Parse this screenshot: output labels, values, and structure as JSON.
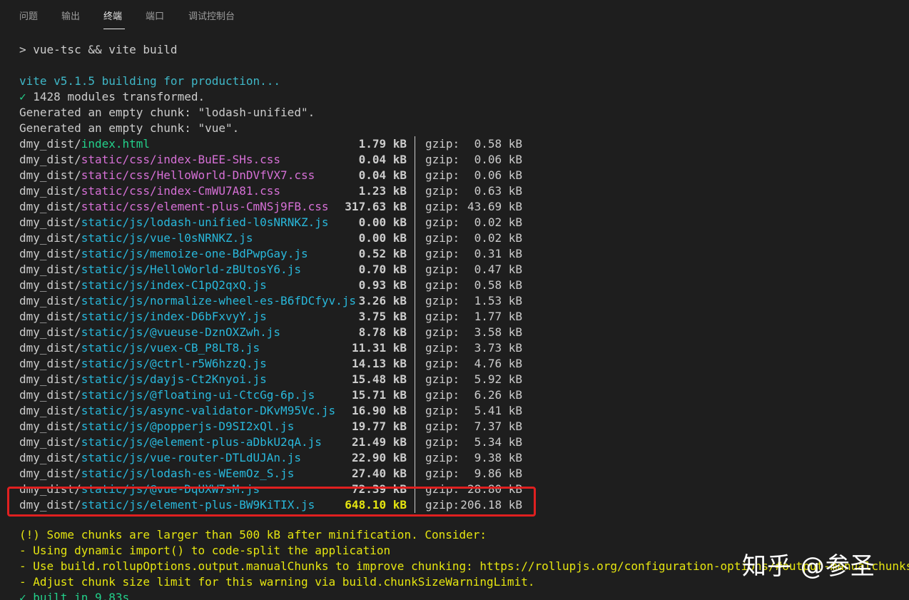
{
  "tabs": [
    {
      "label": "问题"
    },
    {
      "label": "输出"
    },
    {
      "label": "终端"
    },
    {
      "label": "端口"
    },
    {
      "label": "调试控制台"
    }
  ],
  "terminal": {
    "command": "> vue-tsc && vite build",
    "vite_header": "vite v5.1.5 building for production...",
    "check_mark": "✓",
    "modules": " 1428 modules transformed.",
    "empty_chunk_1": "Generated an empty chunk: \"lodash-unified\".",
    "empty_chunk_2": "Generated an empty chunk: \"vue\".",
    "gzip_label": "gzip:",
    "files": [
      {
        "dir": "dmy_dist/",
        "name": "index.html",
        "kind": "html",
        "size": "1.79 kB",
        "gzip": "0.58 kB"
      },
      {
        "dir": "dmy_dist/",
        "name": "static/css/index-BuEE-SHs.css",
        "kind": "css",
        "size": "0.04 kB",
        "gzip": "0.06 kB"
      },
      {
        "dir": "dmy_dist/",
        "name": "static/css/HelloWorld-DnDVfVX7.css",
        "kind": "css",
        "size": "0.04 kB",
        "gzip": "0.06 kB"
      },
      {
        "dir": "dmy_dist/",
        "name": "static/css/index-CmWU7A81.css",
        "kind": "css",
        "size": "1.23 kB",
        "gzip": "0.63 kB"
      },
      {
        "dir": "dmy_dist/",
        "name": "static/css/element-plus-CmNSj9FB.css",
        "kind": "css",
        "size": "317.63 kB",
        "gzip": "43.69 kB"
      },
      {
        "dir": "dmy_dist/",
        "name": "static/js/lodash-unified-l0sNRNKZ.js",
        "kind": "js",
        "size": "0.00 kB",
        "gzip": "0.02 kB"
      },
      {
        "dir": "dmy_dist/",
        "name": "static/js/vue-l0sNRNKZ.js",
        "kind": "js",
        "size": "0.00 kB",
        "gzip": "0.02 kB"
      },
      {
        "dir": "dmy_dist/",
        "name": "static/js/memoize-one-BdPwpGay.js",
        "kind": "js",
        "size": "0.52 kB",
        "gzip": "0.31 kB"
      },
      {
        "dir": "dmy_dist/",
        "name": "static/js/HelloWorld-zBUtosY6.js",
        "kind": "js",
        "size": "0.70 kB",
        "gzip": "0.47 kB"
      },
      {
        "dir": "dmy_dist/",
        "name": "static/js/index-C1pQ2qxQ.js",
        "kind": "js",
        "size": "0.93 kB",
        "gzip": "0.58 kB"
      },
      {
        "dir": "dmy_dist/",
        "name": "static/js/normalize-wheel-es-B6fDCfyv.js",
        "kind": "js",
        "size": "3.26 kB",
        "gzip": "1.53 kB"
      },
      {
        "dir": "dmy_dist/",
        "name": "static/js/index-D6bFxvyY.js",
        "kind": "js",
        "size": "3.75 kB",
        "gzip": "1.77 kB"
      },
      {
        "dir": "dmy_dist/",
        "name": "static/js/@vueuse-DznOXZwh.js",
        "kind": "js",
        "size": "8.78 kB",
        "gzip": "3.58 kB"
      },
      {
        "dir": "dmy_dist/",
        "name": "static/js/vuex-CB_P8LT8.js",
        "kind": "js",
        "size": "11.31 kB",
        "gzip": "3.73 kB"
      },
      {
        "dir": "dmy_dist/",
        "name": "static/js/@ctrl-r5W6hzzQ.js",
        "kind": "js",
        "size": "14.13 kB",
        "gzip": "4.76 kB"
      },
      {
        "dir": "dmy_dist/",
        "name": "static/js/dayjs-Ct2Knyoi.js",
        "kind": "js",
        "size": "15.48 kB",
        "gzip": "5.92 kB"
      },
      {
        "dir": "dmy_dist/",
        "name": "static/js/@floating-ui-CtcGg-6p.js",
        "kind": "js",
        "size": "15.71 kB",
        "gzip": "6.26 kB"
      },
      {
        "dir": "dmy_dist/",
        "name": "static/js/async-validator-DKvM95Vc.js",
        "kind": "js",
        "size": "16.90 kB",
        "gzip": "5.41 kB"
      },
      {
        "dir": "dmy_dist/",
        "name": "static/js/@popperjs-D9SI2xQl.js",
        "kind": "js",
        "size": "19.77 kB",
        "gzip": "7.37 kB"
      },
      {
        "dir": "dmy_dist/",
        "name": "static/js/@element-plus-aDbkU2qA.js",
        "kind": "js",
        "size": "21.49 kB",
        "gzip": "5.34 kB"
      },
      {
        "dir": "dmy_dist/",
        "name": "static/js/vue-router-DTLdUJAn.js",
        "kind": "js",
        "size": "22.90 kB",
        "gzip": "9.38 kB"
      },
      {
        "dir": "dmy_dist/",
        "name": "static/js/lodash-es-WEemOz_S.js",
        "kind": "js",
        "size": "27.40 kB",
        "gzip": "9.86 kB"
      },
      {
        "dir": "dmy_dist/",
        "name": "static/js/@vue-DqUXW7sM.js",
        "kind": "js",
        "size": "72.39 kB",
        "gzip": "28.80 kB"
      },
      {
        "dir": "dmy_dist/",
        "name": "static/js/element-plus-BW9KiTIX.js",
        "kind": "js",
        "size": "648.10 kB",
        "gzip": "206.18 kB",
        "big": true
      }
    ],
    "warnings": [
      "(!) Some chunks are larger than 500 kB after minification. Consider:",
      "- Using dynamic import() to code-split the application",
      "- Use build.rollupOptions.output.manualChunks to improve chunking: https://rollupjs.org/configuration-options/#output-manualchunks",
      "- Adjust chunk size limit for this warning via build.chunkSizeWarningLimit."
    ],
    "built": "✓ built in 9.83s"
  },
  "watermark": "知乎 @参圣",
  "colors": {
    "background": "#1e1e1e",
    "highlight_border": "#e02020"
  }
}
